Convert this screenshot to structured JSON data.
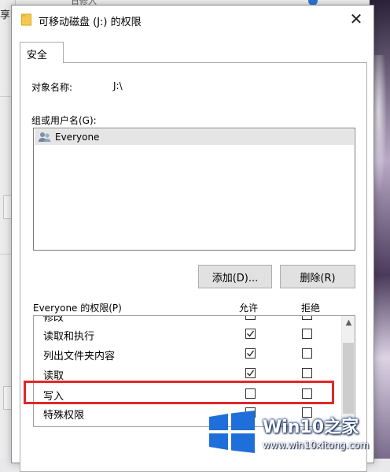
{
  "background": {
    "left_fragment": "享",
    "top_fragment": "日修入"
  },
  "dialog": {
    "title": "可移动磁盘 (J:) 的权限",
    "close_glyph": "✕",
    "tab_label": "安全",
    "object_name_label": "对象名称:",
    "object_name_value": "J:\\",
    "group_label": "组或用户名(G):",
    "groups": [
      {
        "name": "Everyone"
      }
    ],
    "add_button": "添加(D)...",
    "remove_button": "删除(R)",
    "permissions_label": "Everyone 的权限(P)",
    "allow_header": "允许",
    "deny_header": "拒绝",
    "permissions": [
      {
        "name": "修改",
        "allow": false,
        "deny": false
      },
      {
        "name": "读取和执行",
        "allow": true,
        "deny": false
      },
      {
        "name": "列出文件夹内容",
        "allow": true,
        "deny": false
      },
      {
        "name": "读取",
        "allow": true,
        "deny": false
      },
      {
        "name": "写入",
        "allow": false,
        "deny": false
      },
      {
        "name": "特殊权限",
        "allow": false,
        "deny": false
      }
    ]
  },
  "watermark": {
    "title": "Win10之家",
    "subtitle": "www.win10xitong.com",
    "colors": {
      "logo": "#1e6fd9",
      "text": "#ffffff"
    }
  },
  "colors": {
    "highlight": "#e02828",
    "selected_row": "#e5e5e5",
    "button_bg": "#e1e1e1"
  }
}
